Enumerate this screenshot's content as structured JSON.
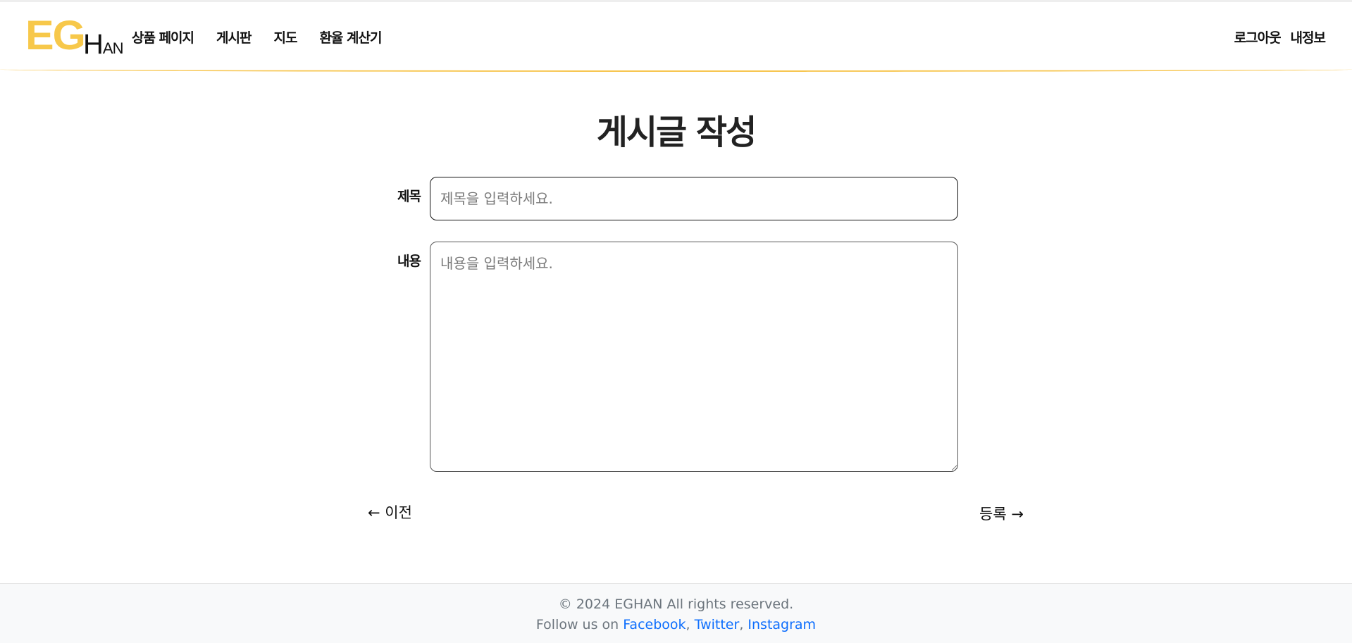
{
  "header": {
    "logo": {
      "eg": "EG",
      "han_first": "H",
      "han_rest": "AN"
    },
    "nav": [
      {
        "label": "상품 페이지"
      },
      {
        "label": "게시판"
      },
      {
        "label": "지도"
      },
      {
        "label": "환율 계산기"
      }
    ],
    "right_nav": [
      {
        "label": "로그아웃"
      },
      {
        "label": "내정보"
      }
    ],
    "accent_color": "#f7c54d"
  },
  "main": {
    "title": "게시글 작성",
    "title_field": {
      "label": "제목",
      "placeholder": "제목을 입력하세요.",
      "value": ""
    },
    "content_field": {
      "label": "내용",
      "placeholder": "내용을 입력하세요.",
      "value": ""
    },
    "prev_button": "← 이전",
    "submit_button": "등록 →"
  },
  "footer": {
    "copyright": "© 2024 EGHAN All rights reserved.",
    "follow_prefix": "Follow us on ",
    "links": [
      {
        "label": "Facebook"
      },
      {
        "label": "Twitter"
      },
      {
        "label": "Instagram"
      }
    ],
    "separator": ", ",
    "link_color": "#0d6efd"
  }
}
